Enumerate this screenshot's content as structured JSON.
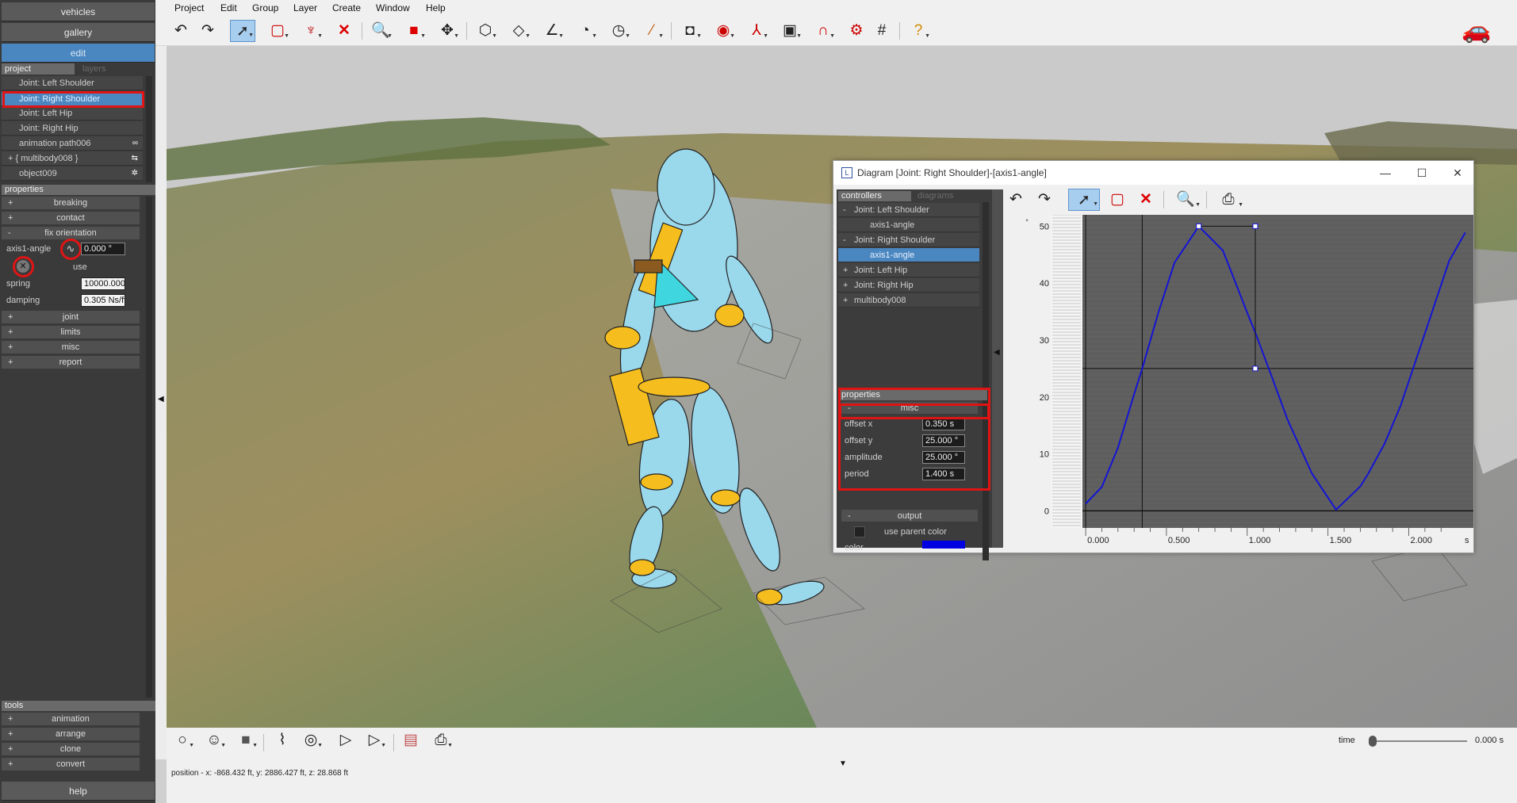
{
  "left_panel": {
    "top_buttons": [
      "vehicles",
      "gallery",
      "edit"
    ],
    "tabs": {
      "project": "project",
      "layers": "layers"
    },
    "tree": [
      {
        "label": "Joint: Left Shoulder",
        "icon": ""
      },
      {
        "label": "Joint: Right Shoulder",
        "icon": ""
      },
      {
        "label": "Joint: Left Hip",
        "icon": ""
      },
      {
        "label": "Joint: Right Hip",
        "icon": ""
      },
      {
        "label": "animation path006",
        "icon": "∞"
      },
      {
        "label": "+ { multibody008 }",
        "icon": "⇆"
      },
      {
        "label": "object009",
        "icon": "✲"
      }
    ],
    "properties_header": "properties",
    "property_sections_top": [
      "breaking",
      "contact",
      "fix orientation"
    ],
    "axis1_angle": {
      "label": "axis1-angle",
      "value": "0.000 °",
      "use_label": "use"
    },
    "spring": {
      "label": "spring",
      "value": "10000.000"
    },
    "damping": {
      "label": "damping",
      "value": "0.305 Ns/ft"
    },
    "property_sections_bottom": [
      "joint",
      "limits",
      "misc",
      "report"
    ],
    "tools_header": "tools",
    "tools": [
      "animation",
      "arrange",
      "clone",
      "convert"
    ],
    "help": "help"
  },
  "menubar": [
    "Project",
    "Edit",
    "Group",
    "Layer",
    "Create",
    "Window",
    "Help"
  ],
  "toolbar_icons": [
    "undo-icon",
    "redo-icon",
    "select-arrow-icon",
    "rectangle-select-icon",
    "tree-prune-icon",
    "delete-x-icon",
    "zoom-icon",
    "cube-icon",
    "move-icon",
    "box-icon",
    "plane-icon",
    "angle-icon",
    "dial-icon",
    "gauge-icon",
    "spring-icon",
    "camera-frame-icon",
    "record-icon",
    "axes-icon",
    "light-icon",
    "magnet-icon",
    "settings-icon",
    "grid-icon",
    "help-icon"
  ],
  "diagram": {
    "title": "Diagram [Joint: Right Shoulder]-[axis1-angle]",
    "tabs": {
      "controllers": "controllers",
      "diagrams": "diagrams"
    },
    "tree": [
      {
        "label": "Joint: Left Shoulder",
        "sign": "-",
        "indent": 0
      },
      {
        "label": "axis1-angle",
        "sign": "",
        "indent": 1
      },
      {
        "label": "Joint: Right Shoulder",
        "sign": "-",
        "indent": 0
      },
      {
        "label": "axis1-angle",
        "sign": "",
        "indent": 1
      },
      {
        "label": "Joint: Left Hip",
        "sign": "+",
        "indent": 0
      },
      {
        "label": "Joint: Right Hip",
        "sign": "+",
        "indent": 0
      },
      {
        "label": "multibody008",
        "sign": "+",
        "indent": 0
      }
    ],
    "properties_header": "properties",
    "misc_header": "misc",
    "fields": [
      {
        "label": "offset x",
        "value": "0.350 s"
      },
      {
        "label": "offset y",
        "value": "25.000 °"
      },
      {
        "label": "amplitude",
        "value": "25.000 °"
      },
      {
        "label": "period",
        "value": "1.400 s"
      }
    ],
    "output_header": "output",
    "use_parent_color": "use parent color",
    "color_label": "color",
    "curve_color": "#1414d4",
    "y_ticks": [
      "50",
      "40",
      "30",
      "20",
      "10",
      "0"
    ],
    "x_ticks": [
      "0.000",
      "0.500",
      "1.000",
      "1.500",
      "2.000"
    ],
    "x_unit": "s",
    "y_header": "°"
  },
  "chart_data": {
    "type": "line",
    "series": [
      {
        "x": [
          0.0,
          0.1,
          0.2,
          0.3,
          0.35,
          0.45,
          0.55,
          0.7,
          0.85,
          1.0,
          1.05,
          1.15,
          1.25,
          1.4,
          1.55,
          1.7,
          1.75,
          1.85,
          1.95,
          2.1,
          2.25,
          2.35
        ],
        "y": [
          1.24,
          4.2,
          11.1,
          20.5,
          25.0,
          34.8,
          43.6,
          50.0,
          45.7,
          34.8,
          31.3,
          23.7,
          16.0,
          6.6,
          0.2,
          4.3,
          6.6,
          11.8,
          18.5,
          31.2,
          43.9,
          48.9
        ]
      }
    ],
    "xlim": [
      -0.02,
      2.4
    ],
    "ylim": [
      -3,
      52
    ],
    "control_points": [
      {
        "x": 0.7,
        "y": 50.0
      },
      {
        "x": 1.05,
        "y": 50.0
      },
      {
        "x": 1.05,
        "y": 25.0
      }
    ],
    "crosshair": {
      "x": 0.35,
      "y": 25.0
    }
  },
  "bottom": {
    "time_label": "time",
    "time_value": "0.000 s",
    "position": "position - x: -868.432 ft, y: 2886.427 ft, z: 28.868 ft"
  }
}
